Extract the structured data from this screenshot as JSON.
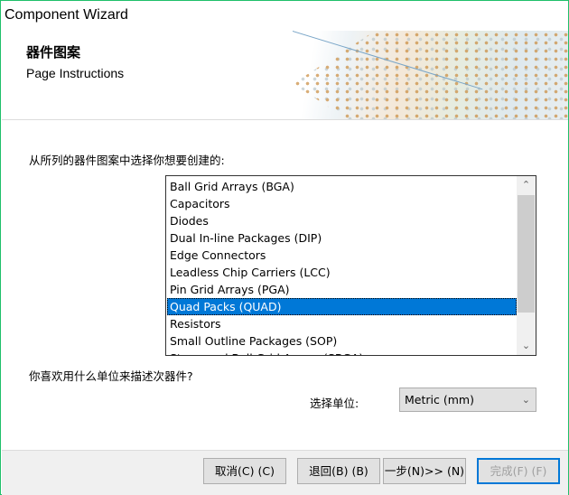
{
  "window": {
    "title": "Component Wizard",
    "border_color": "#1fc06a"
  },
  "header": {
    "title": "器件图案",
    "subtitle": "Page Instructions"
  },
  "pattern_prompt": "从所列的器件图案中选择你想要创建的:",
  "patterns": {
    "items": [
      "Ball Grid Arrays (BGA)",
      "Capacitors",
      "Diodes",
      "Dual In-line Packages (DIP)",
      "Edge Connectors",
      "Leadless Chip Carriers (LCC)",
      "Pin Grid Arrays (PGA)",
      "Quad Packs (QUAD)",
      "Resistors",
      "Small Outline Packages (SOP)",
      "Staggered Ball Grid Arrays (SBGA)"
    ],
    "selected": "Quad Packs (QUAD)",
    "selection_color": "#0078d7"
  },
  "units": {
    "prompt": "你喜欢用什么单位来描述次器件?",
    "label": "选择单位:",
    "value": "Metric (mm)"
  },
  "buttons": {
    "cancel": "取消(C) (C)",
    "back": "退回(B) (B)",
    "next": "一步(N)>> (N)",
    "finish": "完成(F) (F)"
  }
}
